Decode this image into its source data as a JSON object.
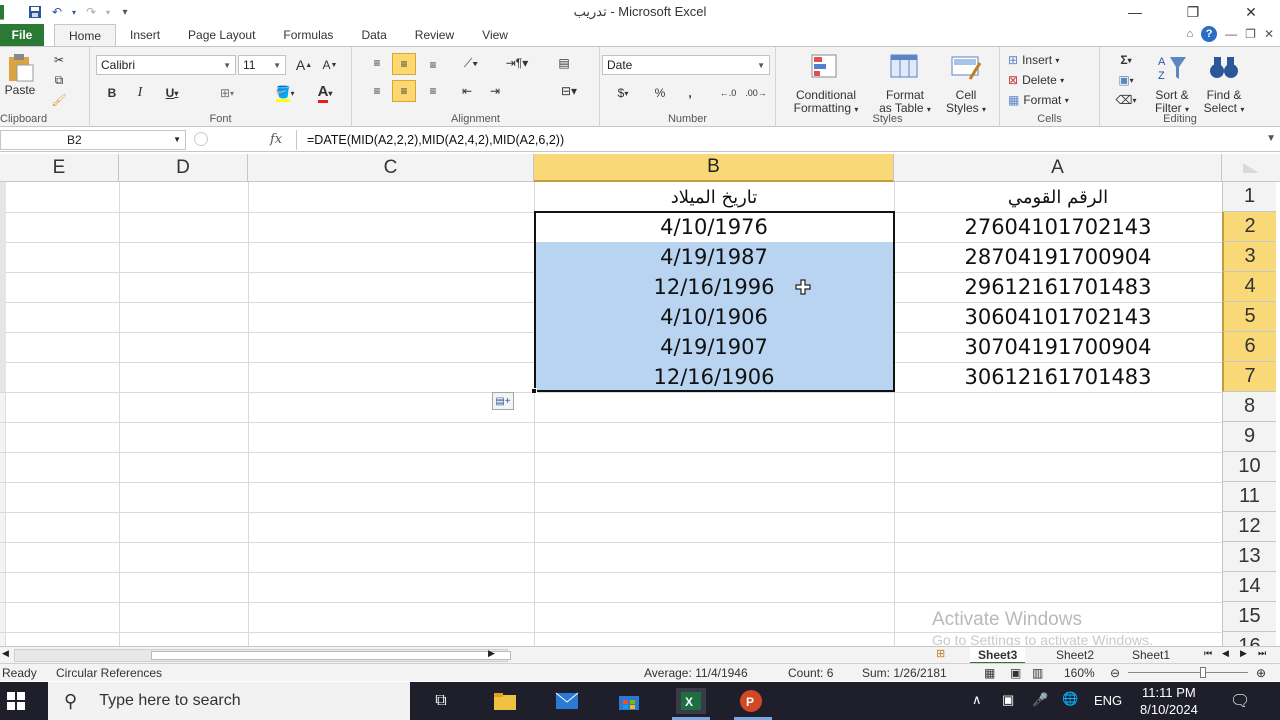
{
  "window": {
    "title": "تدريب  -  Microsoft Excel"
  },
  "tabs": [
    "File",
    "Home",
    "Insert",
    "Page Layout",
    "Formulas",
    "Data",
    "Review",
    "View"
  ],
  "ribbon": {
    "clipboard_label": "Clipboard",
    "paste_label": "Paste",
    "font_label": "Font",
    "font_name": "Calibri",
    "font_size": "11",
    "alignment_label": "Alignment",
    "number_label": "Number",
    "number_format": "Date",
    "styles_label": "Styles",
    "conditional_label_1": "Conditional",
    "conditional_label_2": "Formatting",
    "format_table_label_1": "Format",
    "format_table_label_2": "as Table",
    "cell_styles_label_1": "Cell",
    "cell_styles_label_2": "Styles",
    "cells_label": "Cells",
    "insert_label": "Insert",
    "delete_label": "Delete",
    "format_label": "Format",
    "editing_label": "Editing",
    "sort_label_1": "Sort &",
    "sort_label_2": "Filter",
    "find_label_1": "Find &",
    "find_label_2": "Select"
  },
  "formula_bar": {
    "name_box": "B2",
    "fx": "fx",
    "formula": "=DATE(MID(A2,2,2),MID(A2,4,2),MID(A2,6,2))"
  },
  "sheet": {
    "columns": [
      "E",
      "D",
      "C",
      "B",
      "A"
    ],
    "rows": [
      "1",
      "2",
      "3",
      "4",
      "5",
      "6",
      "7",
      "8",
      "9",
      "10",
      "11",
      "12",
      "13",
      "14",
      "15",
      "16"
    ],
    "header_b": "تاريخ الميلاد",
    "header_a": "الرقم القومي",
    "col_b": [
      "4/10/1976",
      "4/19/1987",
      "12/16/1996",
      "4/10/1906",
      "4/19/1907",
      "12/16/1906"
    ],
    "col_a": [
      "27604101702143",
      "28704191700904",
      "29612161701483",
      "30604101702143",
      "30704191700904",
      "30612161701483"
    ]
  },
  "watermark": {
    "line1": "Activate Windows",
    "line2": "Go to Settings to activate Windows."
  },
  "sheet_tabs": [
    "Sheet3",
    "Sheet2",
    "Sheet1"
  ],
  "status": {
    "ready": "Ready",
    "circular": "Circular References",
    "average": "Average: 11/4/1946",
    "count": "Count: 6",
    "sum": "Sum: 1/26/2181",
    "zoom": "160%"
  },
  "taskbar": {
    "search_placeholder": "Type here to search",
    "lang": "ENG",
    "time": "11:11 PM",
    "date": "8/10/2024"
  }
}
